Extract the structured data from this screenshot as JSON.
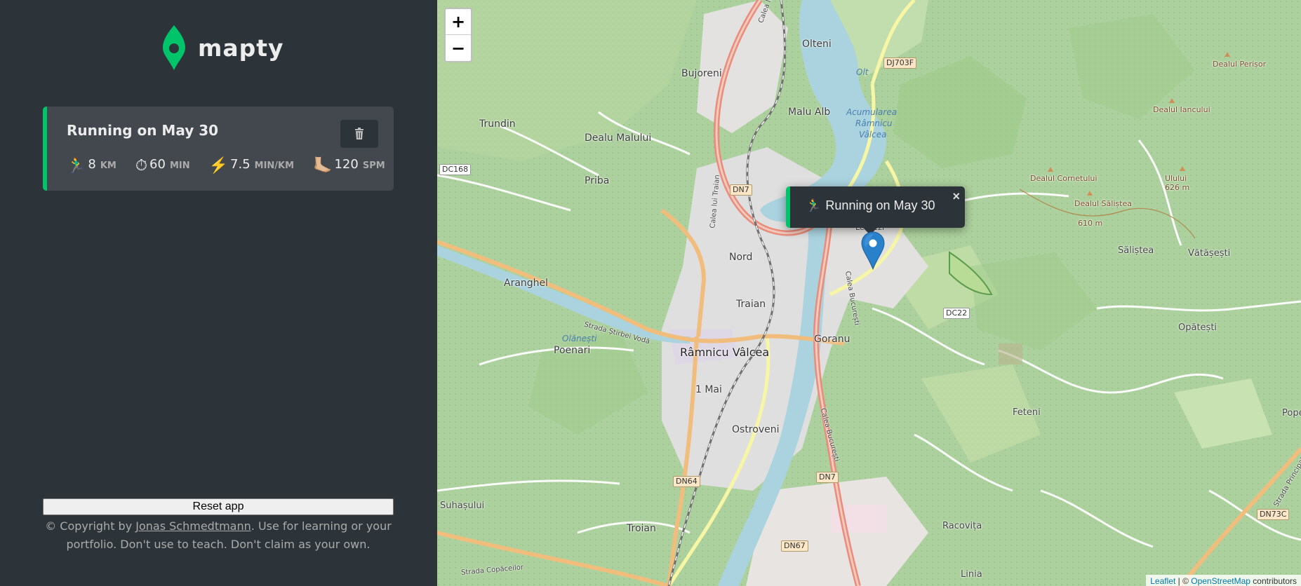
{
  "app": {
    "name": "mapty",
    "brand_color": "#00c46a",
    "sidebar_bg": "#2d3439"
  },
  "workouts": [
    {
      "type": "running",
      "title": "Running on May 30",
      "distance": {
        "icon": "🏃‍♂️",
        "value": "8",
        "unit": "km"
      },
      "duration": {
        "icon": "⏱",
        "value": "60",
        "unit": "min"
      },
      "pace": {
        "icon": "⚡️",
        "value": "7.5",
        "unit": "min/km"
      },
      "cadence": {
        "icon": "🦶🏼",
        "value": "120",
        "unit": "spm"
      }
    }
  ],
  "footer": {
    "reset_label": "Reset app",
    "copyright_prefix": "© Copyright by ",
    "author": "Jonas Schmedtmann",
    "copyright_suffix": ". Use for learning or your portfolio. Don't use to teach. Don't claim as your own."
  },
  "map": {
    "zoom_in": "+",
    "zoom_out": "−",
    "popup": {
      "icon": "🏃‍♂️",
      "text": "Running on May 30",
      "close": "×"
    },
    "attribution": {
      "leaflet": "Leaflet",
      "sep": " | © ",
      "osm": "OpenStreetMap",
      "suffix": " contributors"
    },
    "place_labels": {
      "olteni": "Olteni",
      "bujoreni": "Bujoreni",
      "malu_alb": "Malu Alb",
      "trundin": "Trundin",
      "dealu_malului": "Dealu Malului",
      "priba": "Priba",
      "nord": "Nord",
      "aranghel": "Aranghel",
      "traian": "Traian",
      "goranu": "Goranu",
      "poenari": "Poenari",
      "ramnicu_valcea": "Râmnicu Vâlcea",
      "unu_mai": "1 Mai",
      "ostroveni": "Ostroveni",
      "suhasului": "Suhașului",
      "troian": "Troian",
      "racovita": "Racovița",
      "linia": "Linia",
      "feteni": "Feteni",
      "opatesti": "Opătești",
      "salistea": "Săliștea",
      "vatasesti": "Vătășești",
      "popes": "Popes",
      "lespezi": "Lespezi"
    },
    "peaks": {
      "perisor": "Dealul Perișor",
      "iancului": "Dealul Iancului",
      "cornetului": "Dealul Cornetului",
      "ulului": "Ulului",
      "ulului_alt": "626 m",
      "salistea": "Dealul Săliștea",
      "salistea_alt": "610 m"
    },
    "water_labels": {
      "acumularea_1": "Acumularea",
      "acumularea_2": "Râmnicu",
      "acumularea_3": "Vâlcea",
      "olt": "Olt",
      "olanesti": "Olănești"
    },
    "road_refs": {
      "dj703f": "DJ703F",
      "dc168": "DC168",
      "dn7_top": "DN7",
      "dc22": "DC22",
      "dn64": "DN64",
      "dn7_bottom": "DN7",
      "dn67": "DN67",
      "dn73c": "DN73C"
    },
    "street_labels": {
      "stirbei": "Strada Știrbei Vodă",
      "copaceilor": "Strada Copăceilor",
      "principala": "Strada Principală",
      "bucuresti_1": "Calea București",
      "bucuresti_2": "Calea București",
      "traian": "Calea lui Traian",
      "calea_top": "Calea lu"
    }
  }
}
